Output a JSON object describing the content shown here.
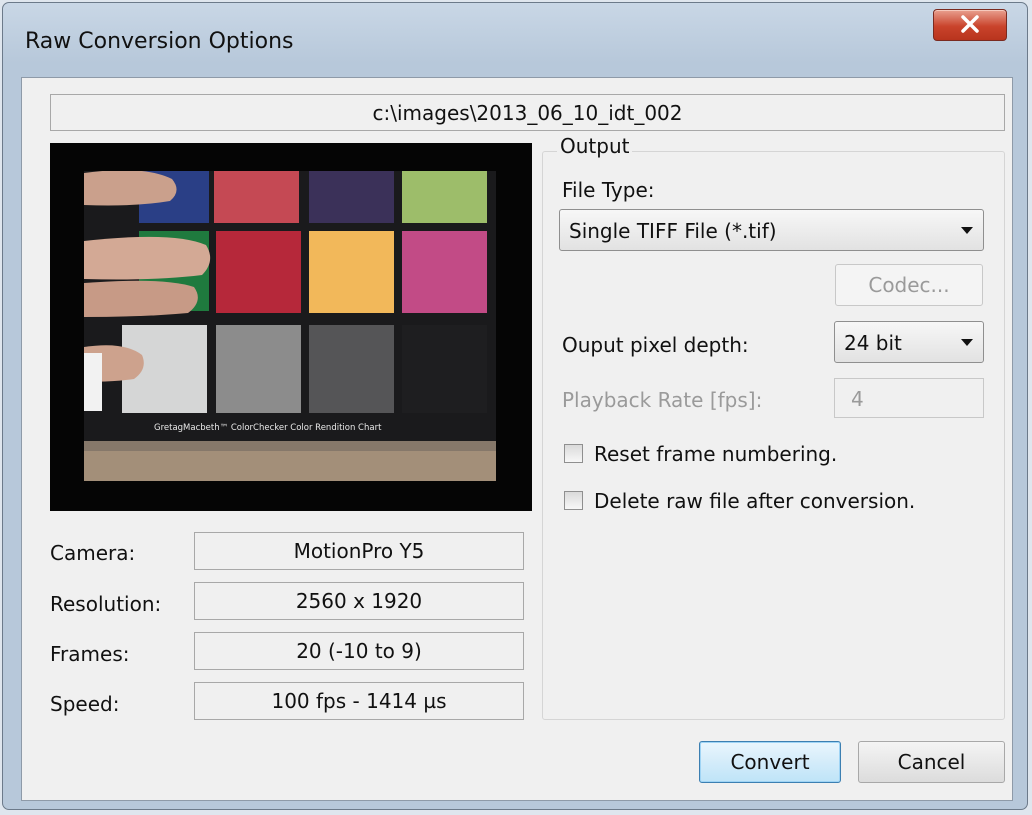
{
  "window": {
    "title": "Raw Conversion Options"
  },
  "file_path": "c:\\images\\2013_06_10_idt_002",
  "preview": {
    "chart_caption": "GretagMacbeth™ ColorChecker Color Rendition Chart"
  },
  "info": {
    "camera_label": "Camera:",
    "camera_value": "MotionPro Y5",
    "resolution_label": "Resolution:",
    "resolution_value": "2560 x 1920",
    "frames_label": "Frames:",
    "frames_value": "20 (-10 to 9)",
    "speed_label": "Speed:",
    "speed_value": "100 fps - 1414 µs"
  },
  "output": {
    "group_title": "Output",
    "file_type_label": "File Type:",
    "file_type_value": "Single TIFF File (*.tif)",
    "codec_button": "Codec...",
    "pixel_depth_label": "Ouput pixel depth:",
    "pixel_depth_value": "24 bit",
    "playback_rate_label": "Playback Rate [fps]:",
    "playback_rate_value": "4",
    "reset_frame_label": "Reset frame numbering.",
    "reset_frame_checked": false,
    "delete_raw_label": "Delete raw file after conversion.",
    "delete_raw_checked": false
  },
  "buttons": {
    "convert": "Convert",
    "cancel": "Cancel"
  }
}
